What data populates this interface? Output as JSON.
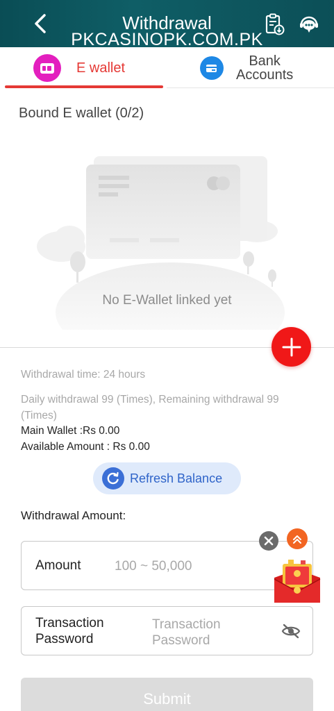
{
  "header": {
    "title": "Withdrawal",
    "subtitle": "PKCASINOPK.COM.PK"
  },
  "tabs": [
    {
      "label": "E wallet",
      "active": true
    },
    {
      "label_line1": "Bank",
      "label_line2": "Accounts",
      "active": false
    }
  ],
  "bound": {
    "title": "Bound E wallet (0/2)",
    "empty_text": "No E-Wallet linked yet"
  },
  "info": {
    "withdrawal_time": "Withdrawal time:   24 hours",
    "daily_line1": "Daily withdrawal 99 (Times), Remaining withdrawal 99",
    "daily_line2": "(Times)",
    "main_wallet": "Main Wallet :Rs 0.00",
    "available": "Available Amount : Rs 0.00"
  },
  "refresh": {
    "label": "Refresh Balance"
  },
  "withdraw": {
    "title": "Withdrawal Amount:",
    "amount_label": "Amount",
    "amount_placeholder": "100 ~ 50,000",
    "password_label_line1": "Transaction",
    "password_label_line2": "Password",
    "password_placeholder_line1": "Transaction",
    "password_placeholder_line2": "Password"
  },
  "submit_label": "Submit",
  "colors": {
    "header_bg": "#0f5e66",
    "accent_red": "#e53935",
    "add_button": "#f01818",
    "ewallet_icon_bg": "#e31fbe",
    "bank_icon_bg": "#1e88e5",
    "refresh_bg": "#dfeafb",
    "refresh_text": "#2f64c9",
    "submit_bg": "#dcdcdc"
  },
  "icons": {
    "back": "chevron-left-icon",
    "records": "clipboard-download-icon",
    "support": "chat-support-icon",
    "ewallet": "wallet-icon",
    "bank": "bank-card-icon",
    "add": "plus-icon",
    "refresh": "refresh-icon",
    "clear": "close-icon",
    "scroll_top": "double-chevron-up-icon",
    "gift": "red-envelope-gift-icon",
    "eye": "eye-off-icon"
  }
}
